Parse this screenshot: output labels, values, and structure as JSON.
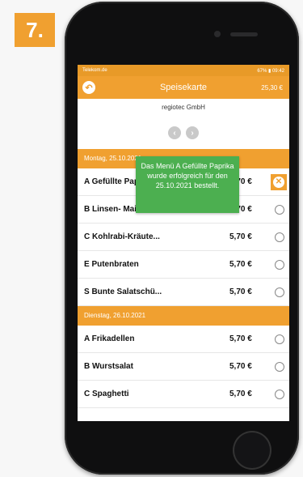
{
  "step": {
    "number": "7."
  },
  "statusbar": {
    "carrier": "Telekom.de",
    "right": "67% ▮ 09:42"
  },
  "appbar": {
    "title": "Speisekarte",
    "balance": "25,30 €"
  },
  "company": "regiotec GmbH",
  "days": [
    {
      "header": "Montag, 25.10.2021",
      "items": [
        {
          "name": "A Gefüllte Paprika",
          "price": "5,70 €",
          "selected": true
        },
        {
          "name": "B Linsen- Mais-Sa...",
          "price": "5,70 €",
          "selected": false
        },
        {
          "name": "C Kohlrabi-Kräute...",
          "price": "5,70 €",
          "selected": false
        },
        {
          "name": "E Putenbraten",
          "price": "5,70 €",
          "selected": false
        },
        {
          "name": "S Bunte Salatschü...",
          "price": "5,70 €",
          "selected": false
        }
      ]
    },
    {
      "header": "Dienstag, 26.10.2021",
      "items": [
        {
          "name": "A Frikadellen",
          "price": "5,70 €",
          "selected": false
        },
        {
          "name": "B Wurstsalat",
          "price": "5,70 €",
          "selected": false
        },
        {
          "name": "C Spaghetti",
          "price": "5,70 €",
          "selected": false
        }
      ]
    }
  ],
  "toast": {
    "message": "Das Menü A Gefüllte Paprika wurde erfolgreich für den 25.10.2021 bestellt."
  },
  "colors": {
    "accent": "#f0a030",
    "toast": "#4caf50"
  },
  "icons": {
    "back": "back-arrow-icon",
    "prev": "chevron-left-icon",
    "next": "chevron-right-icon",
    "cancel": "close-icon"
  }
}
